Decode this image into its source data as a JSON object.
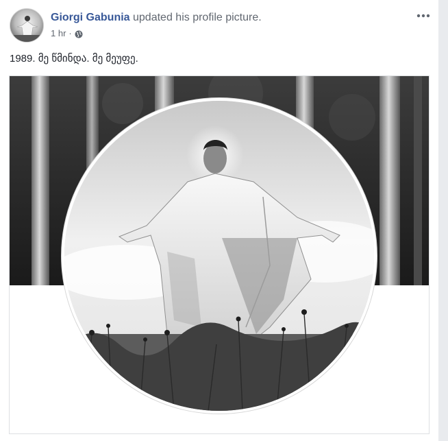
{
  "post": {
    "author": "Giorgi Gabunia",
    "action": " updated his profile picture.",
    "time": "1 hr",
    "separator": "·",
    "privacy_icon": "globe-icon",
    "caption": "1989. მე წმინდა. მე მეუფე.",
    "more_icon": "more-options-icon"
  },
  "colors": {
    "author_link": "#385898",
    "secondary_text": "#616770",
    "body_text": "#1d2129",
    "border": "#dddfe2"
  }
}
